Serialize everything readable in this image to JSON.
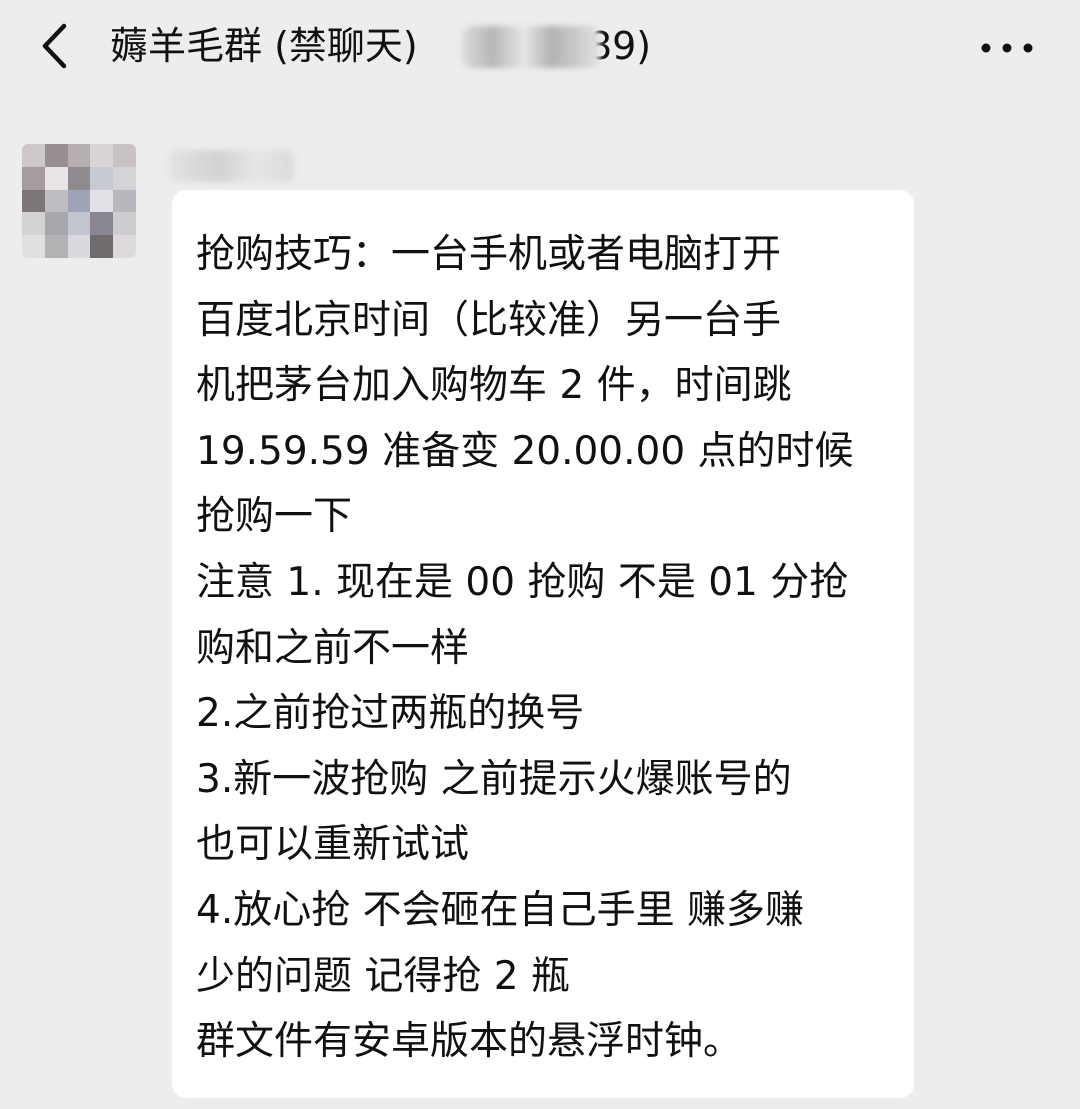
{
  "header": {
    "title_prefix": "薅羊毛群 (禁聊天)",
    "title_suffix": "189)",
    "back_icon": "chevron-left-icon",
    "more_icon": "more-horizontal-icon"
  },
  "message": {
    "lines": [
      "抢购技巧：一台手机或者电脑打开",
      "百度北京时间（比较准）另一台手",
      "机把茅台加入购物车 2 件，时间跳",
      "19.59.59 准备变 20.00.00 点的时候",
      "抢购一下",
      "注意 1. 现在是 00 抢购 不是 01 分抢",
      "购和之前不一样",
      "2.之前抢过两瓶的换号",
      "3.新一波抢购 之前提示火爆账号的",
      "也可以重新试试",
      "4.放心抢 不会砸在自己手里 赚多赚",
      "少的问题 记得抢 2 瓶",
      "群文件有安卓版本的悬浮时钟。"
    ]
  },
  "colors": {
    "background": "#ededed",
    "bubble": "#ffffff",
    "text": "#111111"
  }
}
